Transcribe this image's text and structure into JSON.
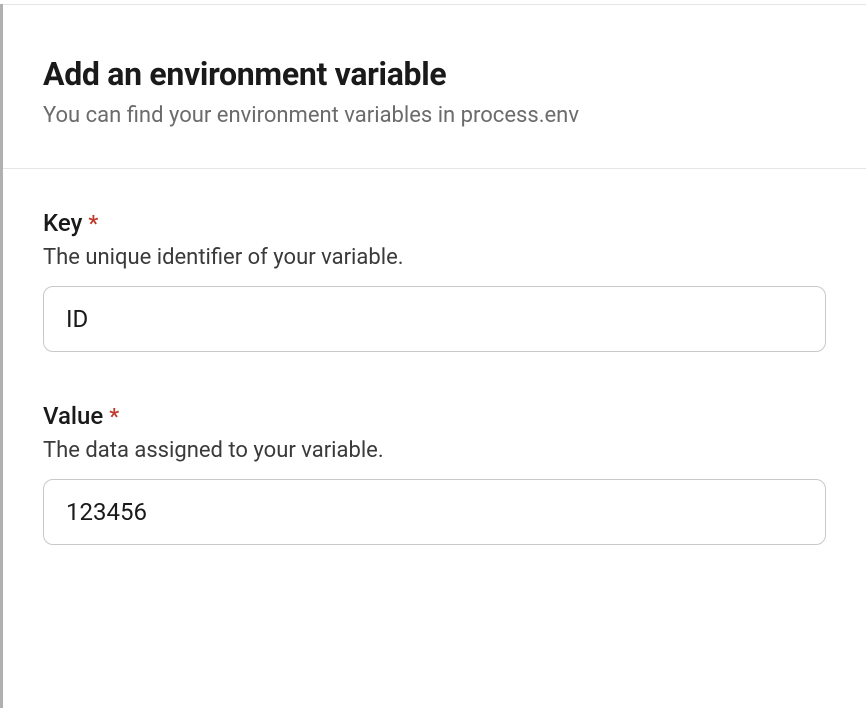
{
  "header": {
    "title": "Add an environment variable",
    "subtitle": "You can find your environment variables in process.env"
  },
  "form": {
    "key": {
      "label": "Key",
      "required_marker": "*",
      "helper": "The unique identifier of your variable.",
      "value": "ID"
    },
    "value": {
      "label": "Value",
      "required_marker": "*",
      "helper": "The data assigned to your variable.",
      "value": "123456"
    }
  }
}
